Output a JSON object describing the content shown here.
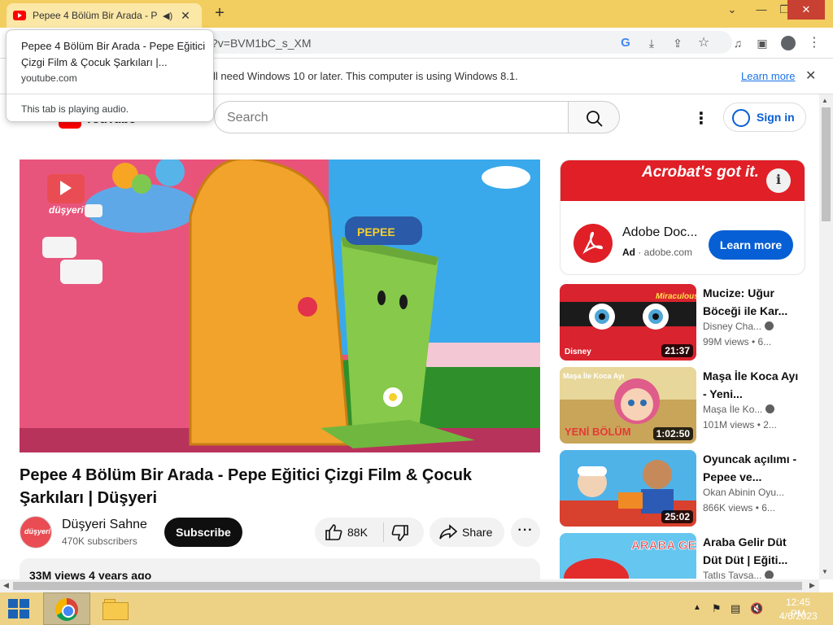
{
  "browser": {
    "tab_title": "Pepee 4 Bölüm Bir Arada - Pe",
    "url_fragment": "?v=BVM1bC_s_XM",
    "new_tab_symbol": "+",
    "window": {
      "tabsearch": "⌄",
      "minimize": "—",
      "restore": "❐",
      "close": "✕"
    }
  },
  "infobar": {
    "message": "ll need Windows 10 or later. This computer is using Windows 8.1.",
    "learn_more": "Learn more",
    "close": "✕"
  },
  "hover_card": {
    "title": "Pepee 4 Bölüm Bir Arada - Pepe Eğitici Çizgi Film & Çocuk Şarkıları |...",
    "domain": "youtube.com",
    "audio_status": "This tab is playing audio."
  },
  "youtube": {
    "logo_text": "YouTube",
    "search_placeholder": "Search",
    "sign_in": "Sign in"
  },
  "player": {
    "channel_watermark": "düşyeri",
    "box_label": "PEPEE"
  },
  "video": {
    "title": "Pepee 4 Bölüm Bir Arada - Pepe Eğitici Çizgi Film & Çocuk Şarkıları | Düşyeri",
    "channel": "Düşyeri Sahne",
    "channel_avatar_text": "düşyeri",
    "subscribers": "470K subscribers",
    "subscribe": "Subscribe",
    "likes": "88K",
    "share": "Share",
    "more": "···",
    "views_date": "33M views  4 years ago"
  },
  "ad": {
    "banner": "Acrobat's got it.",
    "info": "i",
    "name": "Adobe Doc...",
    "ad_label": "Ad",
    "domain": "adobe.com",
    "cta": "Learn more"
  },
  "related": [
    {
      "title": "Mucize: Uğur Böceği ile Kar...",
      "channel": "Disney Cha...",
      "views": "99M views  •  6...",
      "duration": "21:37",
      "thumb_text": "Miraculous",
      "badge": "Disney"
    },
    {
      "title": "Maşa İle Koca Ayı - Yeni...",
      "channel": "Maşa İle Ko...",
      "views": "101M views  •  2...",
      "duration": "1:02:50",
      "thumb_text": "YENİ BÖLÜM",
      "badge": "Maşa İle Koca Ayı"
    },
    {
      "title": "Oyuncak açılımı - Pepee ve...",
      "channel": "Okan Abinin Oyu...",
      "views": "866K views  •  6...",
      "duration": "25:02"
    },
    {
      "title": "Araba Gelir Düt Düt Düt | Eğiti...",
      "channel": "Tatlış Tavşa...",
      "views": "",
      "duration": "",
      "thumb_text": "ARABA GELİR DÜT"
    }
  ],
  "taskbar": {
    "time": "12:45 PM",
    "date": "4/6/2023",
    "tray_up": "▲",
    "tray_flag": "⚑",
    "tray_net": "▤",
    "tray_vol": "🔇"
  },
  "colors": {
    "titlebar": "#f2cd5f",
    "youtube_red": "#ff0000",
    "link_blue": "#065fd4",
    "adobe_red": "#e01f26"
  }
}
